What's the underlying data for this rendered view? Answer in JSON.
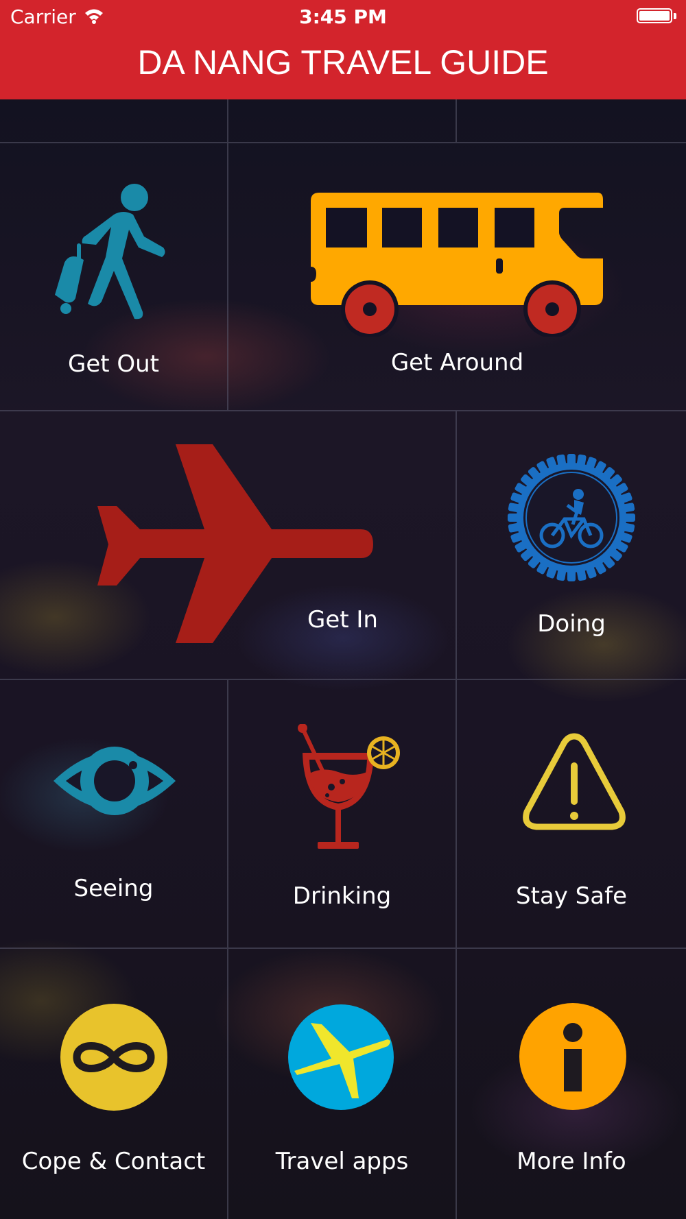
{
  "status_bar": {
    "carrier": "Carrier",
    "time": "3:45 PM"
  },
  "header": {
    "title": "DA NANG TRAVEL GUIDE"
  },
  "tiles": [
    {
      "label": "Get Out",
      "icon": "traveler-walking-icon",
      "color": "#1a8aa8"
    },
    {
      "label": "Get Around",
      "icon": "bus-icon",
      "color": "#ffa800"
    },
    {
      "label": "Get In",
      "icon": "airplane-icon",
      "color": "#a61e18"
    },
    {
      "label": "Doing",
      "icon": "cycling-gear-icon",
      "color": "#1a6fc4"
    },
    {
      "label": "Seeing",
      "icon": "eye-icon",
      "color": "#1a8aa8"
    },
    {
      "label": "Drinking",
      "icon": "cocktail-icon",
      "color": "#b8261e"
    },
    {
      "label": "Stay Safe",
      "icon": "warning-triangle-icon",
      "color": "#e8cb3a"
    },
    {
      "label": "Cope & Contact",
      "icon": "infinity-icon",
      "color": "#e8c32c"
    },
    {
      "label": "Travel apps",
      "icon": "expedia-plane-icon",
      "color": "#00a8dd"
    },
    {
      "label": "More Info",
      "icon": "info-icon",
      "color": "#ffa300"
    }
  ]
}
